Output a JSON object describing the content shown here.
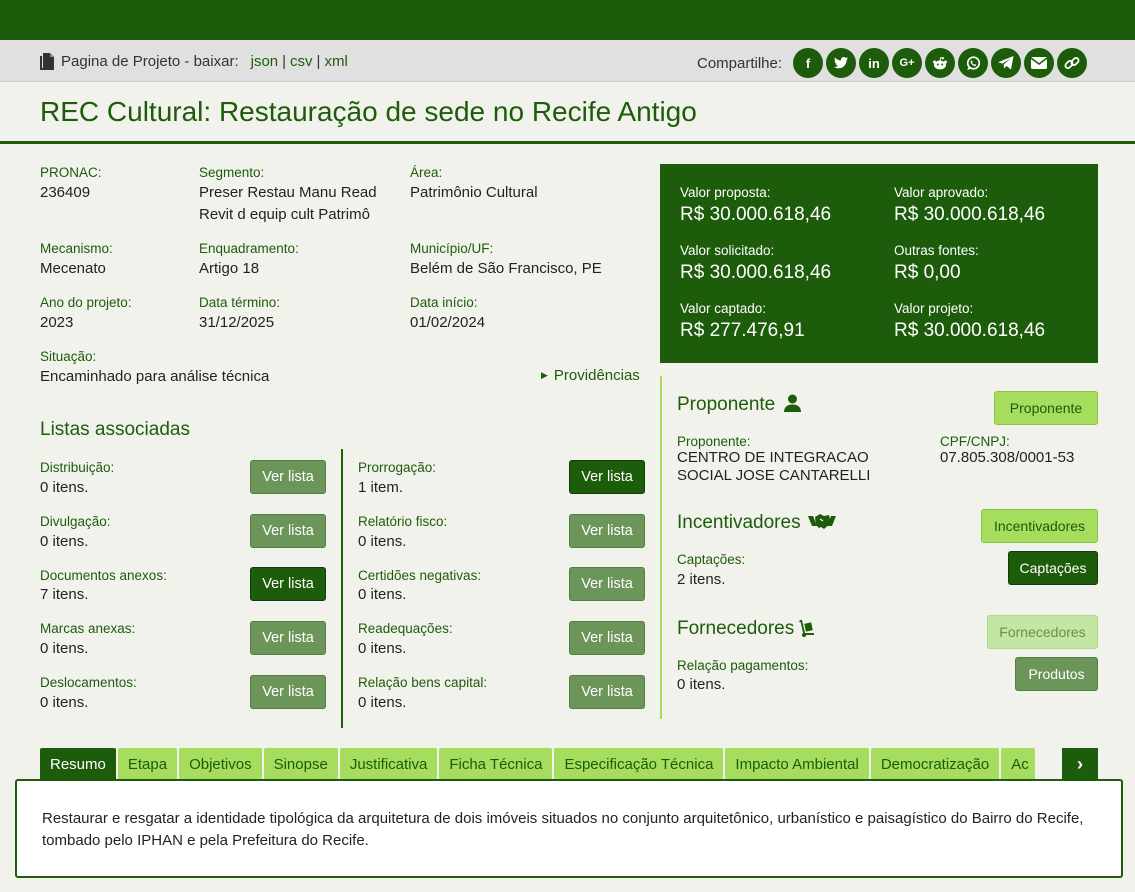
{
  "download": {
    "label": "Pagina de Projeto - baixar:",
    "json": "json",
    "csv": "csv",
    "xml": "xml",
    "sep": "|"
  },
  "share": {
    "label": "Compartilhe:",
    "icons": [
      "facebook-icon",
      "twitter-icon",
      "linkedin-icon",
      "google-plus-icon",
      "reddit-icon",
      "whatsapp-icon",
      "telegram-icon",
      "email-icon",
      "link-icon"
    ]
  },
  "project": {
    "title": "REC Cultural: Restauração de sede no Recife Antigo"
  },
  "info": {
    "pronac": {
      "label": "PRONAC:",
      "value": "236409"
    },
    "segmento": {
      "label": "Segmento:",
      "value1": "Preser Restau Manu Read",
      "value2": "Revit d equip cult Patrimô"
    },
    "area": {
      "label": "Área:",
      "value": "Patrimônio Cultural"
    },
    "mecanismo": {
      "label": "Mecanismo:",
      "value": "Mecenato"
    },
    "enquadramento": {
      "label": "Enquadramento:",
      "value": "Artigo 18"
    },
    "municipio": {
      "label": "Município/UF:",
      "value": "Belém de São Francisco, PE"
    },
    "ano": {
      "label": "Ano do projeto:",
      "value": "2023"
    },
    "termino": {
      "label": "Data término:",
      "value": "31/12/2025"
    },
    "inicio": {
      "label": "Data início:",
      "value": "01/02/2024"
    },
    "situacao": {
      "label": "Situação:",
      "value": "Encaminhado para análise técnica"
    },
    "providencias": "Providências"
  },
  "values": {
    "proposta": {
      "label": "Valor proposta:",
      "value": "R$ 30.000.618,46"
    },
    "aprovado": {
      "label": "Valor aprovado:",
      "value": "R$ 30.000.618,46"
    },
    "solicitado": {
      "label": "Valor solicitado:",
      "value": "R$ 30.000.618,46"
    },
    "outras": {
      "label": "Outras fontes:",
      "value": "R$ 0,00"
    },
    "captado": {
      "label": "Valor captado:",
      "value": "R$ 277.476,91"
    },
    "projeto": {
      "label": "Valor projeto:",
      "value": "R$ 30.000.618,46"
    }
  },
  "listas": {
    "title": "Listas associadas",
    "button": "Ver lista",
    "left": [
      {
        "label": "Distribuição:",
        "count": "0 itens."
      },
      {
        "label": "Divulgação:",
        "count": "0 itens."
      },
      {
        "label": "Documentos anexos:",
        "count": "7 itens."
      },
      {
        "label": "Marcas anexas:",
        "count": "0 itens."
      },
      {
        "label": "Deslocamentos:",
        "count": "0 itens."
      }
    ],
    "right": [
      {
        "label": "Prorrogação:",
        "count": "1 item."
      },
      {
        "label": "Relatório fisco:",
        "count": "0 itens."
      },
      {
        "label": "Certidões negativas:",
        "count": "0 itens."
      },
      {
        "label": "Readequações:",
        "count": "0 itens."
      },
      {
        "label": "Relação bens capital:",
        "count": "0 itens."
      }
    ]
  },
  "proponente": {
    "title": "Proponente",
    "button": "Proponente",
    "name_label": "Proponente:",
    "name1": "CENTRO DE INTEGRACAO",
    "name2": "SOCIAL JOSE CANTARELLI",
    "cnpj_label": "CPF/CNPJ:",
    "cnpj": "07.805.308/0001-53"
  },
  "incentivadores": {
    "title": "Incentivadores",
    "button": "Incentivadores",
    "captacoes_label": "Captações:",
    "captacoes": "2 itens.",
    "captacoes_button": "Captações"
  },
  "fornecedores": {
    "title": "Fornecedores",
    "button": "Fornecedores",
    "pagamentos_label": "Relação pagamentos:",
    "pagamentos": "0 itens.",
    "produtos_button": "Produtos"
  },
  "tabs": [
    "Resumo",
    "Etapa",
    "Objetivos",
    "Sinopse",
    "Justificativa",
    "Ficha Técnica",
    "Especificação Técnica",
    "Impacto Ambiental",
    "Democratização",
    "Ac"
  ],
  "resumo": "Restaurar e resgatar a identidade tipológica da arquitetura de dois imóveis situados no conjunto arquitetônico, urbanístico e paisagístico do Bairro do Recife, tombado pelo IPHAN e pela Prefeitura do Recife."
}
